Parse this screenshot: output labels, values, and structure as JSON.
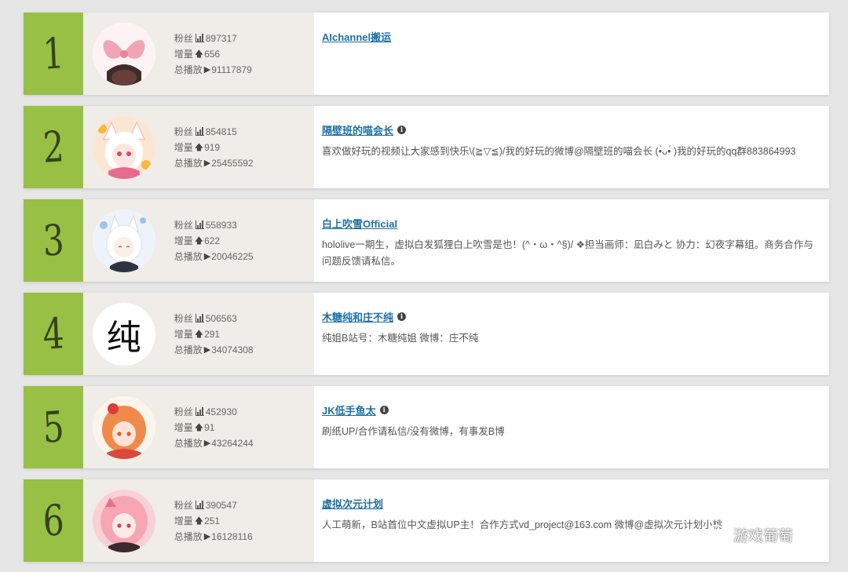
{
  "watermark": {
    "text": "游戏葡萄",
    "icon": "wechat-icon"
  },
  "stat_labels": {
    "fans": "粉丝",
    "increase": "增量",
    "plays": "总播放"
  },
  "icons": {
    "fans": "bar-chart-icon",
    "increase": "arrow-up-icon",
    "plays": "play-icon",
    "info": "info-icon"
  },
  "colors": {
    "rank_bg": "#98c045",
    "name_link": "#1d6fa5",
    "panel_bg": "#f0ece7"
  },
  "rows": [
    {
      "rank": "1",
      "fans": "897317",
      "increase": "656",
      "plays": "91117879",
      "name": "AIchannel搬运",
      "has_info": false,
      "desc": "",
      "avatar": "pink-bow-avatar"
    },
    {
      "rank": "2",
      "fans": "854815",
      "increase": "919",
      "plays": "25455592",
      "name": "隔壁班的喵会长",
      "has_info": true,
      "desc": "喜欢做好玩的视频让大家感到快乐\\(≧▽≦)/我的好玩的微博@隔壁班的喵会长 (•̀ᴗ•́ )我的好玩的qq群883864993",
      "avatar": "catgirl-avatar"
    },
    {
      "rank": "3",
      "fans": "558933",
      "increase": "622",
      "plays": "20046225",
      "name": "白上吹雪Official",
      "has_info": false,
      "desc": "hololive一期生，虚拟白发狐狸白上吹雪是也！(^・ω・^§)/ ❖担当画师：凪白みと 协力：幻夜字幕组。商务合作与问题反馈请私信。",
      "avatar": "white-fox-avatar"
    },
    {
      "rank": "4",
      "fans": "506563",
      "increase": "291",
      "plays": "34074308",
      "name": "木糖纯和庄不纯",
      "has_info": true,
      "desc": "纯姐B站号：木糖纯姐 微博：庄不纯",
      "avatar": "纯"
    },
    {
      "rank": "5",
      "fans": "452930",
      "increase": "91",
      "plays": "43264244",
      "name": "JK低手鱼太",
      "has_info": true,
      "desc": "刷纸UP/合作请私信/没有微博，有事发B博",
      "avatar": "orange-hair-avatar"
    },
    {
      "rank": "6",
      "fans": "390547",
      "increase": "251",
      "plays": "16128116",
      "name": "虚拟次元计划",
      "has_info": false,
      "desc": "人工萌新，B站首位中文虚拟UP主！合作方式vd_project@163.com 微博@虚拟次元计划小桃",
      "avatar": "pink-hair-avatar"
    }
  ]
}
